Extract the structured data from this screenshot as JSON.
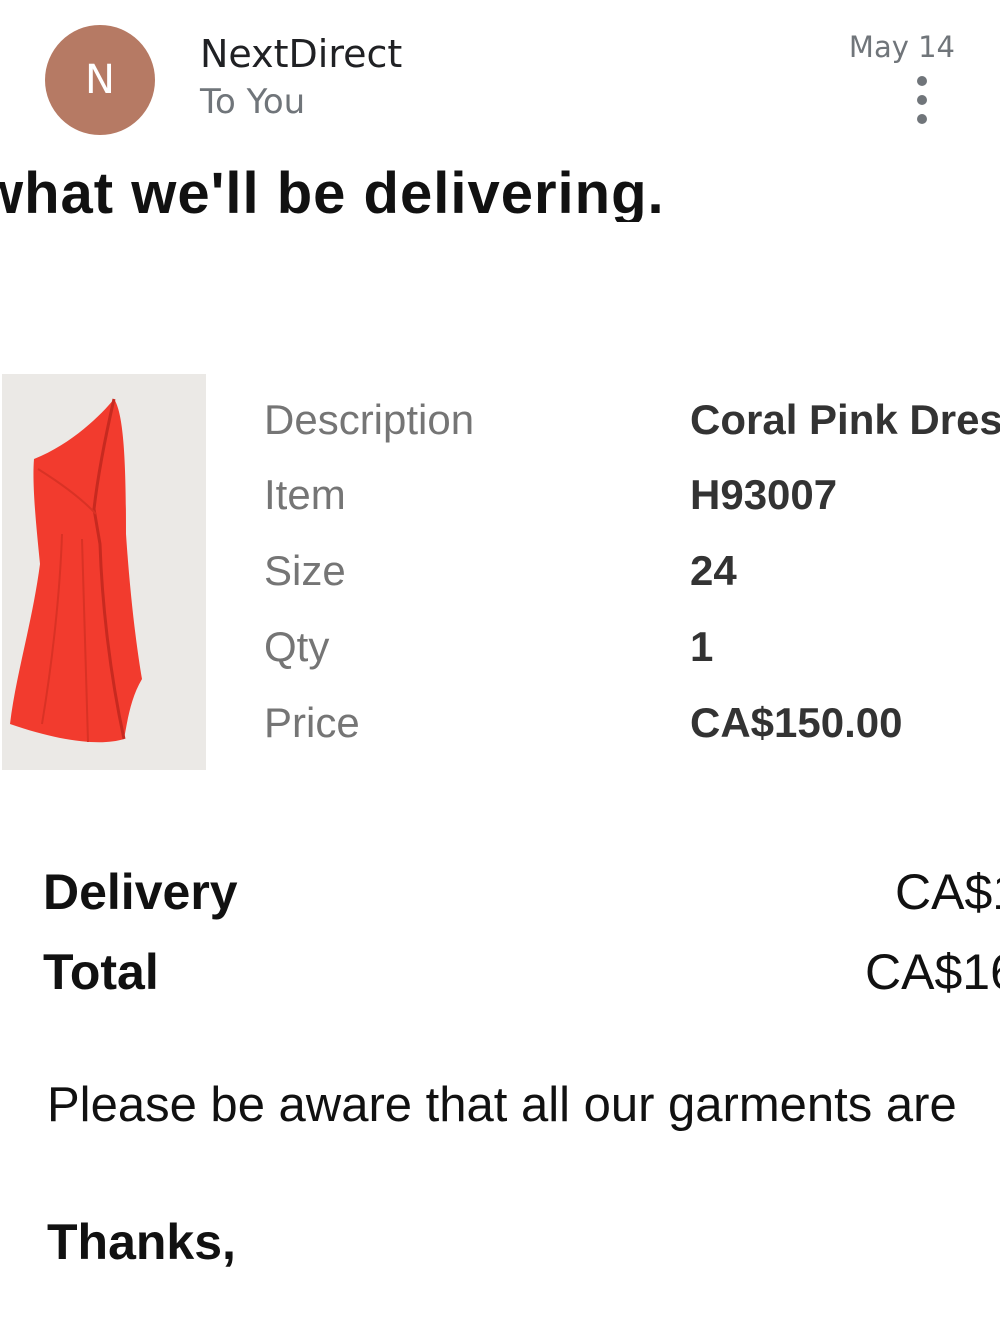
{
  "header": {
    "avatar_letter": "N",
    "avatar_color": "#b67a64",
    "sender": "NextDirect",
    "recipient": "To You",
    "date": "May 14",
    "more_icon": "more-vert-icon"
  },
  "body": {
    "cutoff_heading": "what we'll be delivering.",
    "product": {
      "image_icon": "coral-pink-dress-image",
      "details": [
        {
          "label": "Description",
          "value": "Coral Pink Dres"
        },
        {
          "label": "Item",
          "value": "H93007"
        },
        {
          "label": "Size",
          "value": "24"
        },
        {
          "label": "Qty",
          "value": "1"
        },
        {
          "label": "Price",
          "value": "CA$150.00"
        }
      ]
    },
    "totals": {
      "delivery_label": "Delivery",
      "delivery_value": "CA$1",
      "total_label": "Total",
      "total_value": "CA$16"
    },
    "notice": "Please be aware that all our garments are",
    "thanks": "Thanks,"
  },
  "colors": {
    "dress": "#f23b2e",
    "image_background": "#ebe9e6",
    "label_gray": "#757575"
  }
}
